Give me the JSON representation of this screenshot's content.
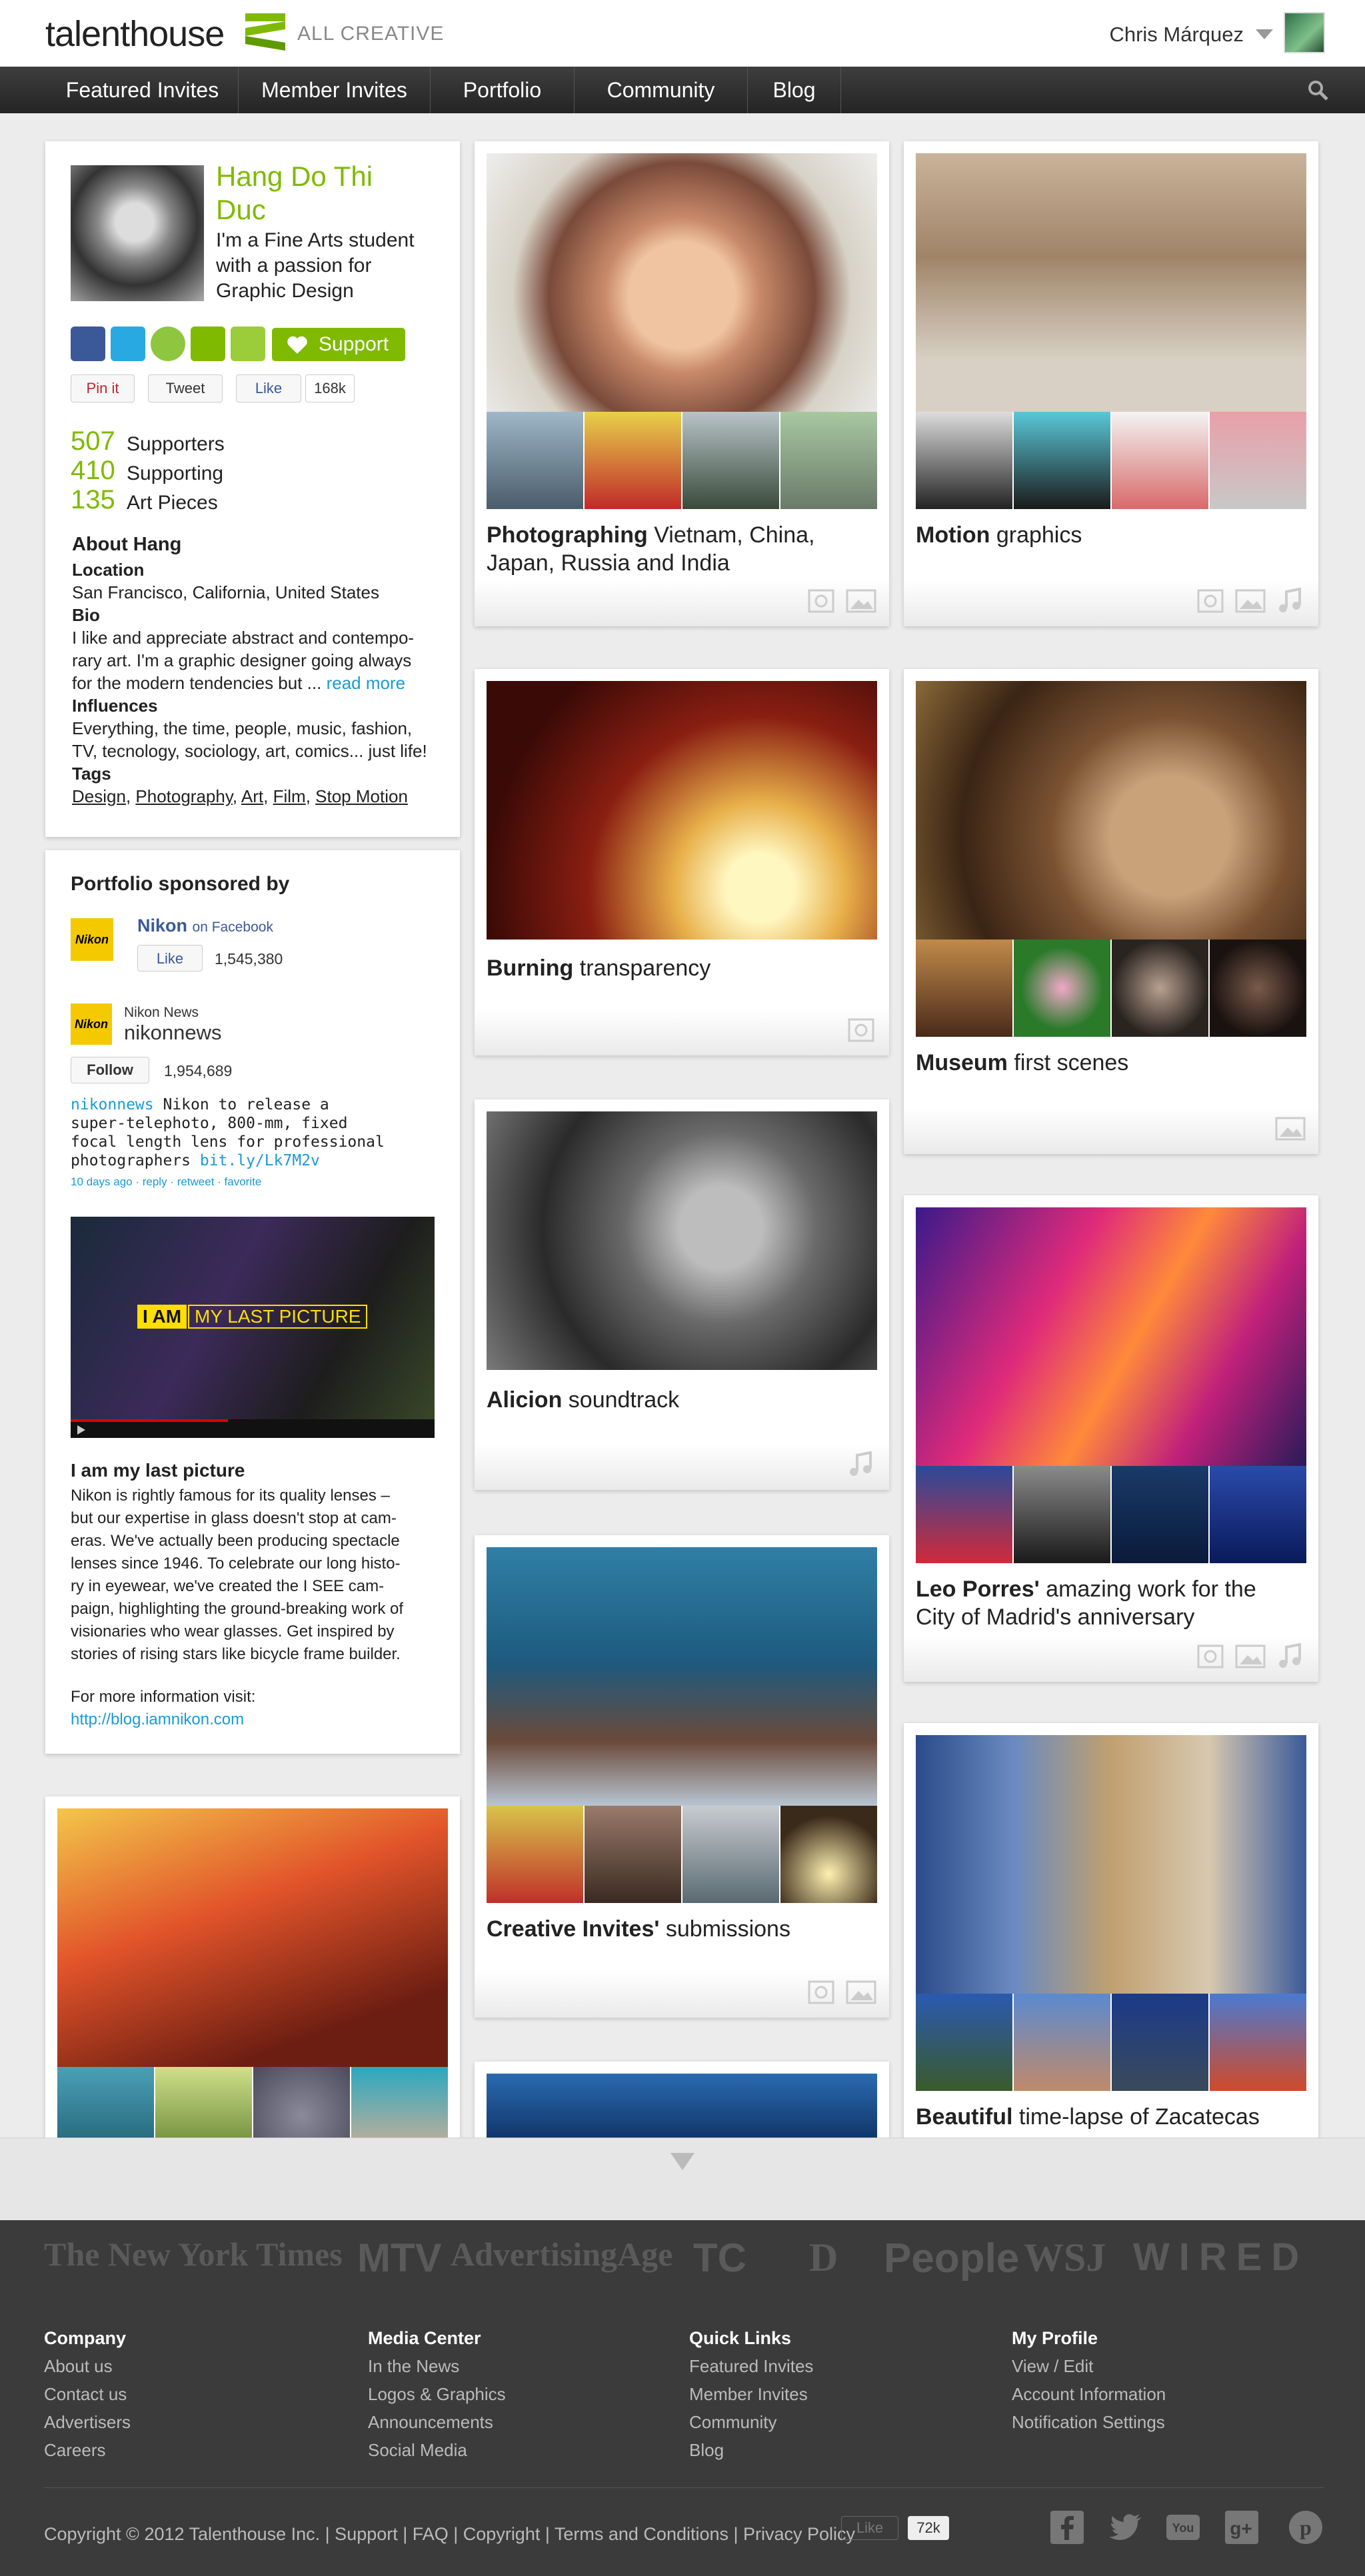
{
  "header": {
    "logo": "talenthouse",
    "tagline": "ALL CREATIVE",
    "user_name": "Chris Márquez"
  },
  "nav": [
    "Featured Invites",
    "Member Invites",
    "Portfolio",
    "Community",
    "Blog"
  ],
  "profile": {
    "name": "Hang Do Thi Duc",
    "description": "I'm a Fine Arts student with a passion for Graphic Design",
    "support_label": "Support",
    "pin_label": "Pin it",
    "tweet_label": "Tweet",
    "like_label": "Like",
    "like_count": "168k",
    "stats": [
      {
        "value": "507",
        "label": "Supporters"
      },
      {
        "value": "410",
        "label": "Supporting"
      },
      {
        "value": "135",
        "label": "Art Pieces"
      }
    ],
    "about_title": "About Hang",
    "location_label": "Location",
    "location": "San Francisco, California, United States",
    "bio_label": "Bio",
    "bio_l1": "I like and appreciate abstract and contempo-",
    "bio_l2": "rary art. I'm a graphic designer going always",
    "bio_l3": "for the modern tendencies but ...",
    "read_more": "read more",
    "influences_label": "Influences",
    "influences_l1": "Everything, the time, people, music, fashion,",
    "influences_l2": "TV, tecnology, sociology, art, comics... just life!",
    "tags_label": "Tags",
    "tags": [
      "Design",
      "Photography",
      "Art",
      "Film",
      "Stop Motion"
    ]
  },
  "sponsor": {
    "title": "Portfolio sponsored by",
    "nikon_logo": "Nikon",
    "fb_name": "Nikon",
    "fb_on": "on Facebook",
    "fb_like": "Like",
    "fb_count": "1,545,380",
    "news_label": "Nikon News",
    "handle": "nikonnews",
    "follow_label": "Follow",
    "followers": "1,954,689",
    "tweet_handle": "nikonnews",
    "tweet_l1": "Nikon to release a",
    "tweet_l2": "super-telephoto, 800-mm, fixed",
    "tweet_l3": "focal length lens for professional",
    "tweet_l4": "photographers",
    "tweet_link": "bit.ly/Lk7M2v",
    "tweet_meta": "10 days ago · reply · retweet · favorite",
    "video_caption_a": "I AM",
    "video_caption_b": "MY LAST PICTURE",
    "video_title": "I am my last picture",
    "video_text": [
      "Nikon is rightly famous for its quality lenses –",
      "but our expertise in glass doesn't stop at cam-",
      "eras. We've actually been producing spectacle",
      "lenses since 1946. To celebrate our long histo-",
      "ry in eyewear, we've created the I SEE cam-",
      "paign, highlighting the ground-breaking work of",
      "visionaries who wear glasses.  Get inspired by",
      "stories of rising stars like bicycle frame builder."
    ],
    "more_info": "For more information visit:",
    "more_link": "http://blog.iamnikon.com"
  },
  "cards": {
    "c1": {
      "bold": "Photographing",
      "rest": " Vietnam, China,",
      "line2": "Japan, Russia and India"
    },
    "c2": {
      "bold": "Motion",
      "rest": " graphics"
    },
    "c3": {
      "bold": "Burning",
      "rest": " transparency"
    },
    "c4": {
      "bold": "Museum",
      "rest": " first scenes"
    },
    "c5": {
      "bold": "Alicion",
      "rest": " soundtrack"
    },
    "c6": {
      "bold": "Leo Porres'",
      "rest": " amazing work for the",
      "line2": "City of Madrid's anniversary"
    },
    "c7": {
      "bold": "Creative Invites'",
      "rest": " submissions"
    },
    "c8": {
      "bold": "Beautiful",
      "rest": " time-lapse of Zacatecas"
    }
  },
  "press": [
    "The New York Times",
    "MTV",
    "AdvertisingAge",
    "TC",
    "D",
    "People",
    "WSJ",
    "WIRED"
  ],
  "footer": {
    "columns": [
      {
        "title": "Company",
        "items": [
          "About us",
          "Contact us",
          "Advertisers",
          "Careers"
        ]
      },
      {
        "title": "Media Center",
        "items": [
          "In the News",
          "Logos & Graphics",
          "Announcements",
          "Social Media"
        ]
      },
      {
        "title": "Quick Links",
        "items": [
          "Featured Invites",
          "Member Invites",
          "Community",
          "Blog"
        ]
      },
      {
        "title": "My Profile",
        "items": [
          "View / Edit",
          "Account Information",
          "Notification Settings"
        ]
      }
    ],
    "copyright": "Copyright © 2012 Talenthouse Inc.  |  Support  |  FAQ  |  Copyright  |  Terms and Conditions  |  Privacy Policy",
    "like_label": "Like",
    "like_count": "72k"
  },
  "colors": {
    "accent": "#7fba00",
    "link": "#1a9ad6",
    "nav": "#2e2e2e",
    "footer": "#3b3b3b"
  }
}
